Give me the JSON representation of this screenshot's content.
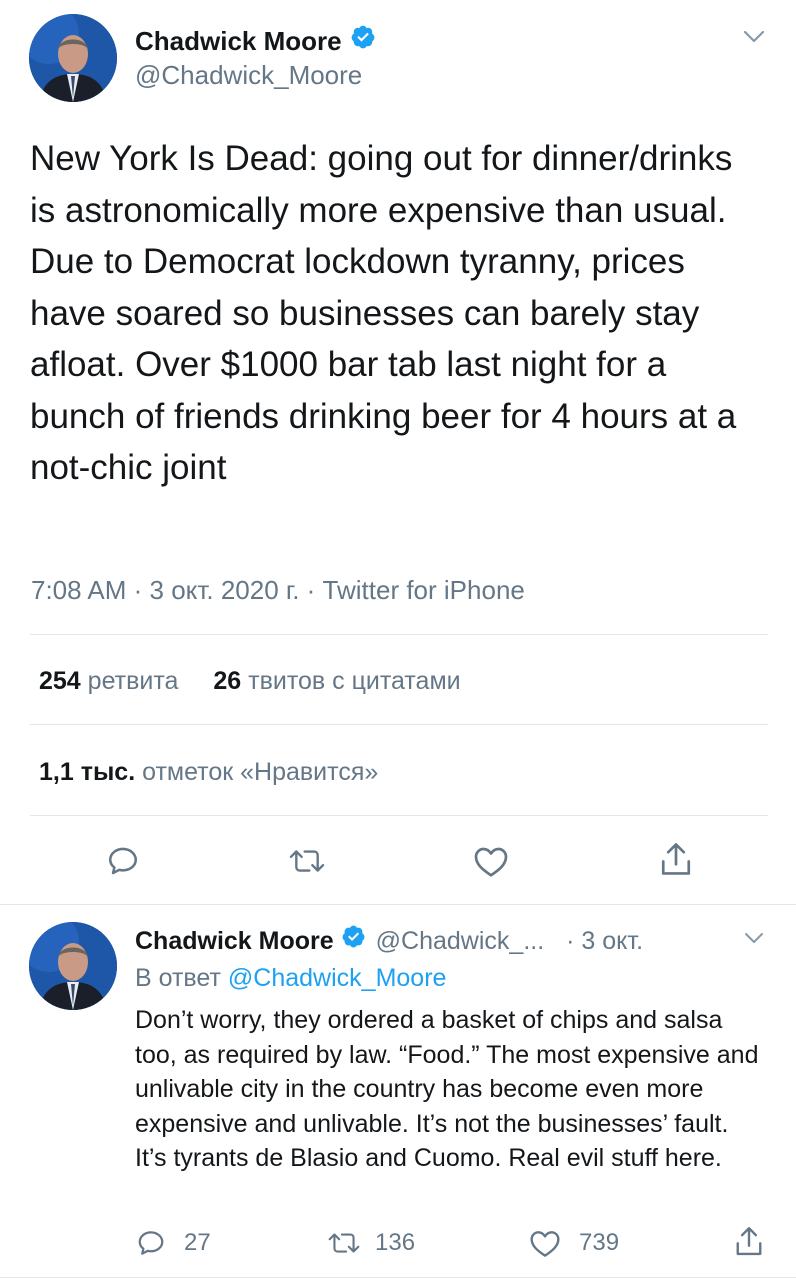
{
  "main_tweet": {
    "author_name": "Chadwick Moore",
    "author_handle": "@Chadwick_Moore",
    "text": "New York Is Dead: going out for dinner/drinks is astronomically more expensive than usual. Due to Democrat lockdown tyranny, prices have soared so businesses can barely stay afloat. Over $1000 bar tab last night for a bunch of friends drinking beer for 4 hours at a not-chic joint",
    "time": "7:08 AM",
    "date": "3 окт. 2020 г.",
    "source": "Twitter for iPhone",
    "retweets_count": "254",
    "retweets_label": "ретвита",
    "quotes_count": "26",
    "quotes_label": "твитов с цитатами",
    "likes_count": "1,1 тыс.",
    "likes_label": "отметок «Нравится»"
  },
  "reply_tweet": {
    "author_name": "Chadwick Moore",
    "author_handle": "@Chadwick_...",
    "date": "· 3 окт.",
    "reply_prefix": "В ответ",
    "reply_to": "@Chadwick_Moore",
    "text": "Don’t worry, they ordered a basket of chips and salsa too, as required by law. “Food.” The most expensive and unlivable city in the country has become even more expensive and unlivable. It’s not the businesses’ fault. It’s tyrants de Blasio and Cuomo. Real evil stuff here.",
    "reply_count": "27",
    "retweet_count": "136",
    "like_count": "739"
  },
  "icons": {
    "verified": "verified-badge-icon",
    "menu": "chevron-down-icon",
    "reply": "reply-icon",
    "retweet": "retweet-icon",
    "like": "heart-icon",
    "share": "share-icon"
  },
  "colors": {
    "accent": "#1da1f2",
    "text": "#14171a",
    "muted": "#657786",
    "divider": "#e1e8ed"
  }
}
